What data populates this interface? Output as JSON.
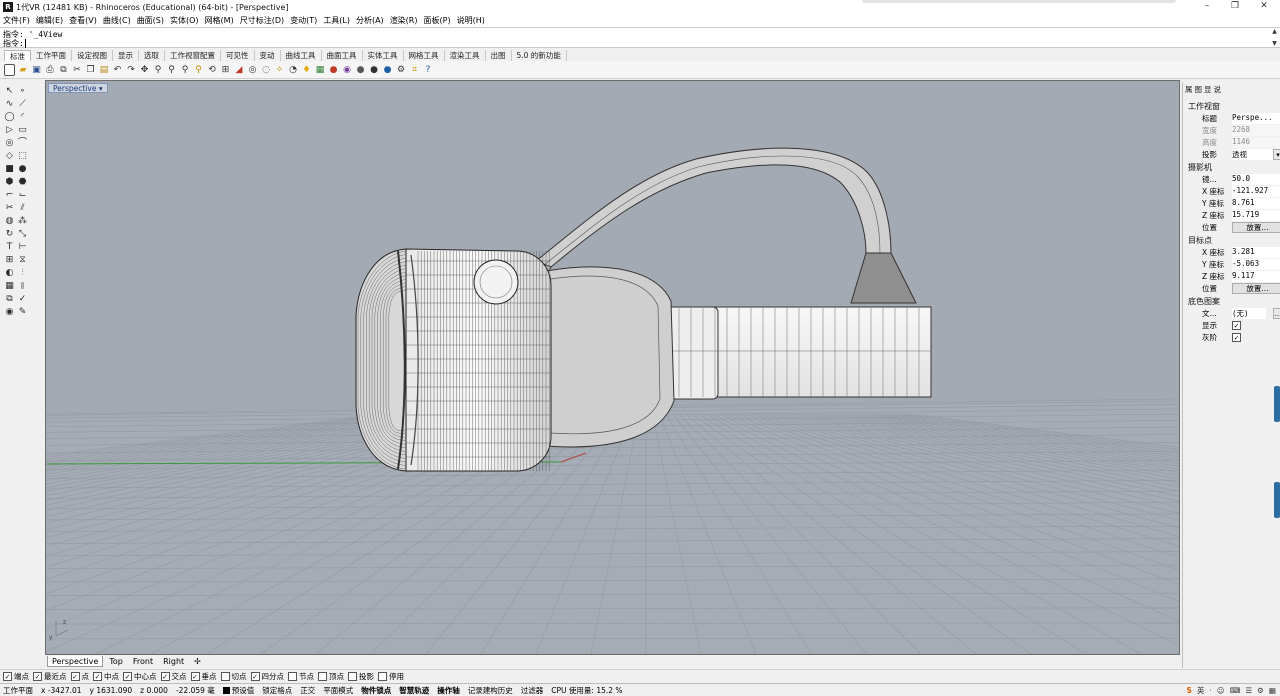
{
  "window": {
    "icon_text": "R",
    "title": "1代VR (12481 KB) - Rhinoceros (Educational) (64-bit) - [Perspective]",
    "minimize": "–",
    "maximize": "❐",
    "close": "✕"
  },
  "menu": [
    "文件(F)",
    "编辑(E)",
    "查看(V)",
    "曲线(C)",
    "曲面(S)",
    "实体(O)",
    "网格(M)",
    "尺寸标注(D)",
    "变动(T)",
    "工具(L)",
    "分析(A)",
    "渲染(R)",
    "面板(P)",
    "说明(H)"
  ],
  "command": {
    "history": "指令: '_4View",
    "prompt": "指令:",
    "scroll_up": "▲",
    "scroll_down": "▼"
  },
  "tabs": [
    "标准",
    "工作平面",
    "设定视图",
    "显示",
    "选取",
    "工作视窗配置",
    "可见性",
    "变动",
    "曲线工具",
    "曲面工具",
    "实体工具",
    "网格工具",
    "渲染工具",
    "出图",
    "5.0 的新功能"
  ],
  "toolbar_icons": [
    "new-icon",
    "open-icon",
    "save-icon",
    "print-icon",
    "import-icon",
    "cut-icon",
    "copy-icon",
    "paste-icon",
    "undo-icon",
    "redo-icon",
    "pan-icon",
    "zoom-icon",
    "zoom-window-icon",
    "zoom-extents-icon",
    "zoom-selected-icon",
    "rotate-view-icon",
    "four-view-icon",
    "cplane-icon",
    "show-hide-icon",
    "lock-icon",
    "point-icon",
    "curve-icon",
    "light-icon",
    "layer-icon",
    "material-icon",
    "render-icon",
    "sphere-icon",
    "sun-icon",
    "shade-icon",
    "options-icon",
    "snap-icon",
    "help-icon"
  ],
  "viewport": {
    "label": "Perspective",
    "label_arrow": "▾",
    "background": "#a4aab3",
    "grid_color": "#8d939c",
    "axis_x_color": "#b0403a",
    "axis_y_color": "#3a9a3a",
    "axis_labels": {
      "x": "x",
      "y": "y",
      "z": "z"
    }
  },
  "viewport_tabs": [
    "Perspective",
    "Top",
    "Front",
    "Right",
    "✢"
  ],
  "osnaps": [
    {
      "label": "端点",
      "checked": true
    },
    {
      "label": "最近点",
      "checked": true
    },
    {
      "label": "点",
      "checked": true
    },
    {
      "label": "中点",
      "checked": true
    },
    {
      "label": "中心点",
      "checked": true
    },
    {
      "label": "交点",
      "checked": true
    },
    {
      "label": "垂点",
      "checked": true
    },
    {
      "label": "切点",
      "checked": false
    },
    {
      "label": "四分点",
      "checked": true
    },
    {
      "label": "节点",
      "checked": false
    },
    {
      "label": "顶点",
      "checked": false
    },
    {
      "label": "投影",
      "checked": false
    },
    {
      "label": "停用",
      "checked": false
    }
  ],
  "status": {
    "cplane": "工作平面",
    "x": "x -3427.01",
    "y": "y 1631.090",
    "z": "z 0.000",
    "dist": "-22.059 毫",
    "layer": "预设值",
    "grid_snap": "锁定格点",
    "ortho": "正交",
    "planar": "平面模式",
    "osnap": "物件锁点",
    "smarttrack": "智慧轨迹",
    "gumball": "操作轴",
    "history": "记录建构历史",
    "filter": "过滤器",
    "cpu": "CPU 使用量: 15.2 %",
    "tray": [
      "S",
      "英",
      "·",
      "☺",
      "⌨",
      "☰",
      "⚙",
      "▦"
    ]
  },
  "panel": {
    "tabs": [
      "属",
      "图",
      "显",
      "说"
    ],
    "section_viewport": "工作视窗",
    "title_label": "标题",
    "title_value": "Perspe...",
    "width_label": "宽度",
    "width_value": "2268",
    "height_label": "高度",
    "height_value": "1146",
    "projection_label": "投影",
    "projection_value": "透视",
    "section_camera": "摄影机",
    "lens_label": "镜...",
    "lens_value": "50.0",
    "cam_x_label": "X 座标",
    "cam_x_value": "-121.927",
    "cam_y_label": "Y 座标",
    "cam_y_value": "8.761",
    "cam_z_label": "Z 座标",
    "cam_z_value": "15.719",
    "cam_pos_label": "位置",
    "cam_pos_btn": "放置...",
    "section_target": "目标点",
    "tgt_x_label": "X 座标",
    "tgt_x_value": "3.281",
    "tgt_y_label": "Y 座标",
    "tgt_y_value": "-5.063",
    "tgt_z_label": "Z 座标",
    "tgt_z_value": "9.117",
    "tgt_pos_label": "位置",
    "tgt_pos_btn": "放置...",
    "section_bg": "底色图案",
    "file_label": "文...",
    "file_value": "(无)",
    "file_btn": "...",
    "show_label": "显示",
    "gray_label": "灰阶",
    "checked_mark": "✓",
    "dd_arrow": "▾"
  }
}
